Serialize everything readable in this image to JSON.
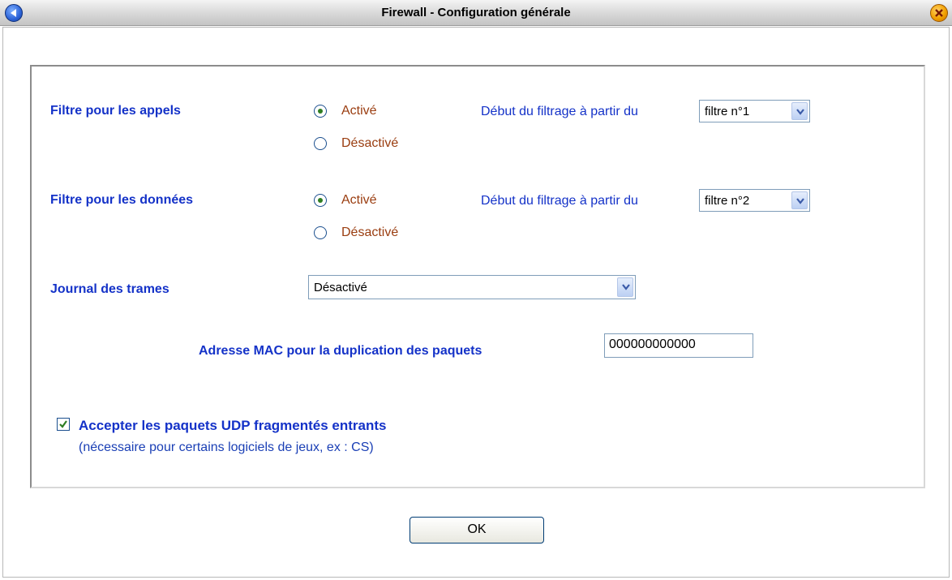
{
  "window": {
    "title": "Firewall - Configuration générale"
  },
  "calls_filter": {
    "label": "Filtre pour les appels",
    "options": [
      "Activé",
      "Désactivé"
    ],
    "selected": "Activé",
    "start_label": "Début du filtrage à partir du",
    "start_value": "filtre n°1"
  },
  "data_filter": {
    "label": "Filtre pour les données",
    "options": [
      "Activé",
      "Désactivé"
    ],
    "selected": "Activé",
    "start_label": "Début du filtrage à partir du",
    "start_value": "filtre n°2"
  },
  "frame_log": {
    "label": "Journal des trames",
    "value": "Désactivé"
  },
  "mac": {
    "label": "Adresse MAC pour la duplication des paquets",
    "value": "000000000000"
  },
  "udp": {
    "checked": true,
    "label": "Accepter les paquets UDP fragmentés entrants",
    "note": "(nécessaire pour certains logiciels de jeux, ex : CS)"
  },
  "ok_label": "OK",
  "icons": {
    "back": "back-arrow-icon",
    "close": "close-icon",
    "dropdown": "chevron-down-icon",
    "check": "checkmark-icon"
  },
  "colors": {
    "label_blue": "#1432c8",
    "radio_text": "#9a3d10",
    "radio_dot": "#2e7d23"
  }
}
